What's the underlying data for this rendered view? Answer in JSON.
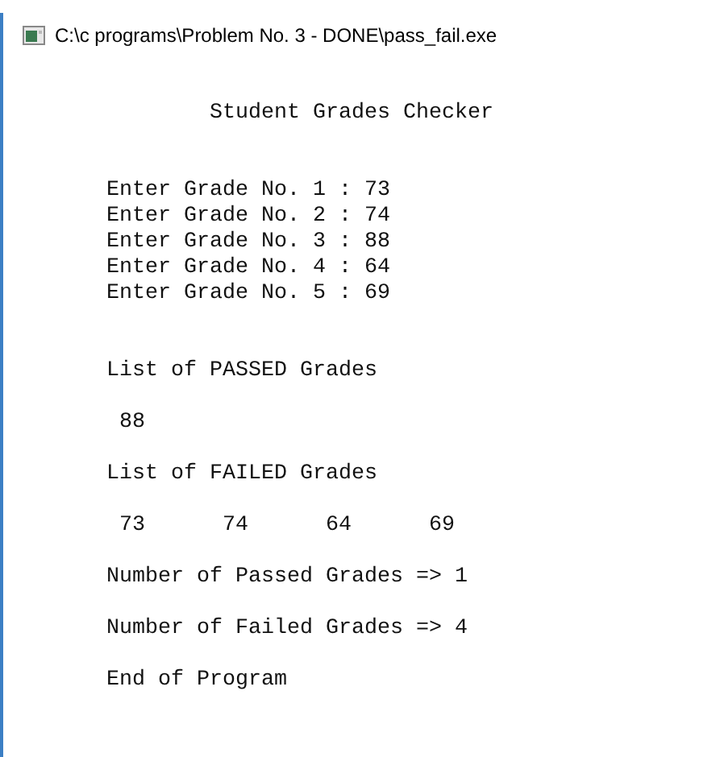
{
  "window": {
    "title": "C:\\c programs\\Problem No. 3 - DONE\\pass_fail.exe"
  },
  "console": {
    "heading": "Student Grades Checker",
    "inputs": [
      "Enter Grade No. 1 : 73",
      "Enter Grade No. 2 : 74",
      "Enter Grade No. 3 : 88",
      "Enter Grade No. 4 : 64",
      "Enter Grade No. 5 : 69"
    ],
    "passed_title": "List of PASSED Grades",
    "passed": [
      "88"
    ],
    "failed_title": "List of FAILED Grades",
    "failed": [
      "73",
      "74",
      "64",
      "69"
    ],
    "summary": [
      "Number of Passed Grades => 1",
      "Number of Failed Grades => 4",
      "End of Program"
    ]
  }
}
